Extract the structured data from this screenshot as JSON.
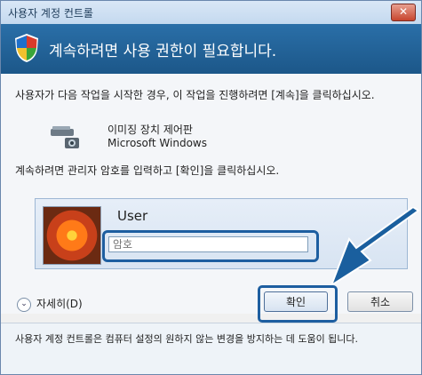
{
  "titlebar": {
    "title": "사용자 계정 컨트롤",
    "close_label": "✕"
  },
  "banner": {
    "message": "계속하려면 사용 권한이 필요합니다."
  },
  "content": {
    "description": "사용자가 다음 작업을 시작한 경우, 이 작업을 진행하려면 [계속]을 클릭하십시오.",
    "app": {
      "name": "이미징 장치 제어판",
      "publisher": "Microsoft Windows",
      "icon": "scanner-camera-icon"
    },
    "prompt": "계속하려면 관리자 암호를 입력하고 [확인]을 클릭하십시오."
  },
  "credential": {
    "username": "User",
    "password_placeholder": "암호",
    "avatar": "flower-avatar"
  },
  "actions": {
    "details_label": "자세히(D)",
    "ok_label": "확인",
    "cancel_label": "취소"
  },
  "footer": {
    "text": "사용자 계정 컨트롤은 컴퓨터 설정의 원하지 않는 변경을 방지하는 데 도움이 됩니다."
  },
  "colors": {
    "banner": "#1c5789",
    "highlight": "#1d5ea0",
    "arrow": "#1a5f9e"
  }
}
